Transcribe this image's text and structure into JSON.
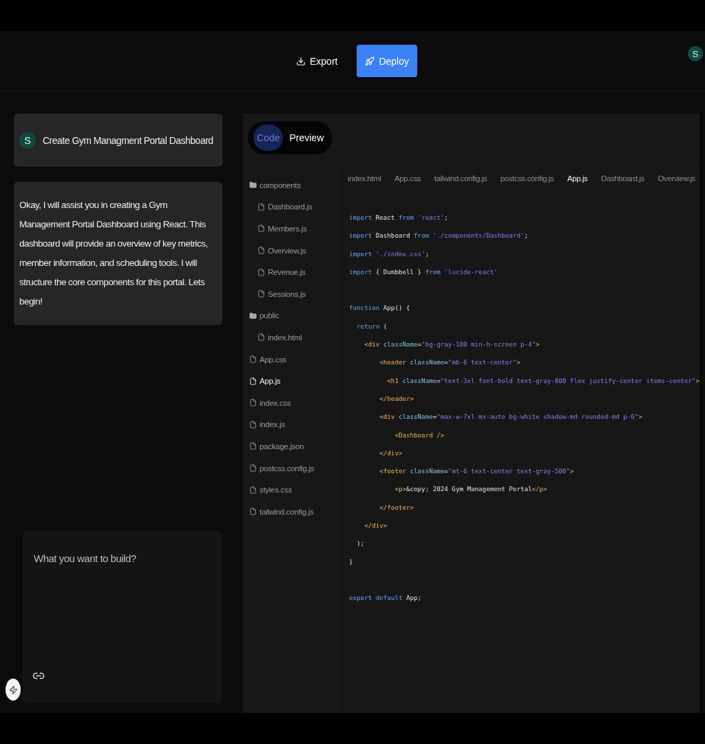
{
  "header": {
    "buttons": [
      {
        "label": "Export",
        "kind": "export"
      },
      {
        "label": "Deploy",
        "kind": "deploy"
      }
    ],
    "avatar": "S"
  },
  "chat": {
    "messages": [
      {
        "kind": "user",
        "avatar": "S",
        "text": "Create Gym Managment Portal Dashboard"
      },
      {
        "kind": "assistant",
        "text": "Okay, I will assist you in creating a Gym Management Portal Dashboard using React. This dashboard will provide an overview of key metrics, member information, and scheduling tools. I will structure the core components for this portal. Lets begin!"
      }
    ],
    "prompt": {
      "placeholder": "What you want to build?"
    }
  },
  "view_toggle": [
    {
      "label": "Code",
      "selected": true
    },
    {
      "label": "Preview",
      "selected": false
    }
  ],
  "file_tree": [
    {
      "name": "components",
      "kind": "folder",
      "selected": false,
      "children": [
        {
          "name": "Dashboard.js",
          "kind": "file",
          "selected": false
        },
        {
          "name": "Members.js",
          "kind": "file",
          "selected": false
        },
        {
          "name": "Overview.js",
          "kind": "file",
          "selected": false
        },
        {
          "name": "Revenue.js",
          "kind": "file",
          "selected": false
        },
        {
          "name": "Sessions.js",
          "kind": "file",
          "selected": false
        }
      ]
    },
    {
      "name": "public",
      "kind": "folder",
      "selected": false,
      "children": [
        {
          "name": "index.html",
          "kind": "file",
          "selected": false
        }
      ]
    },
    {
      "name": "App.css",
      "kind": "file",
      "selected": false
    },
    {
      "name": "App.js",
      "kind": "file",
      "selected": true
    },
    {
      "name": "index.css",
      "kind": "file",
      "selected": false
    },
    {
      "name": "index.js",
      "kind": "file",
      "selected": false
    },
    {
      "name": "package.json",
      "kind": "file",
      "selected": false
    },
    {
      "name": "postcss.config.js",
      "kind": "file",
      "selected": false
    },
    {
      "name": "styles.css",
      "kind": "file",
      "selected": false
    },
    {
      "name": "tailwind.config.js",
      "kind": "file",
      "selected": false
    }
  ],
  "editor_tabs": [
    {
      "label": "index.html",
      "selected": false
    },
    {
      "label": "App.css",
      "selected": false
    },
    {
      "label": "tailwind.config.js",
      "selected": false
    },
    {
      "label": "postcss.config.js",
      "selected": false
    },
    {
      "label": "App.js",
      "selected": true
    },
    {
      "label": "Dashboard.js",
      "selected": false
    },
    {
      "label": "Overview.js",
      "selected": false
    }
  ],
  "code_blocks": [
    [
      [
        {
          "kind": "keyword",
          "text": "import"
        },
        {
          "kind": "plain",
          "text": " React "
        },
        {
          "kind": "keyword",
          "text": "from"
        },
        {
          "kind": "string",
          "text": " 'react'"
        },
        {
          "kind": "plain",
          "text": ";"
        }
      ],
      [
        {
          "kind": "keyword",
          "text": "import"
        },
        {
          "kind": "plain",
          "text": " Dashboard "
        },
        {
          "kind": "keyword",
          "text": "from"
        },
        {
          "kind": "string",
          "text": " './components/Dashboard'"
        },
        {
          "kind": "plain",
          "text": ";"
        }
      ],
      [
        {
          "kind": "keyword",
          "text": "import"
        },
        {
          "kind": "string",
          "text": " './index.css'"
        },
        {
          "kind": "plain",
          "text": ";"
        }
      ],
      [
        {
          "kind": "keyword",
          "text": "import"
        },
        {
          "kind": "plain",
          "text": " { Dumbbell } "
        },
        {
          "kind": "keyword",
          "text": "from"
        },
        {
          "kind": "string",
          "text": " 'lucide-react'"
        }
      ]
    ],
    [
      [
        {
          "kind": "keyword",
          "text": "function"
        },
        {
          "kind": "plain",
          "text": " App() {"
        }
      ],
      [
        {
          "kind": "keyword",
          "text": "  return"
        },
        {
          "kind": "plain",
          "text": " ("
        }
      ],
      [
        {
          "kind": "tag",
          "text": "    <div"
        },
        {
          "kind": "attr",
          "text": " className"
        },
        {
          "kind": "plain",
          "text": "="
        },
        {
          "kind": "string",
          "text": "\"bg-gray-100 min-h-screen p-4\""
        },
        {
          "kind": "tag",
          "text": ">"
        }
      ],
      [
        {
          "kind": "tag",
          "text": "        <header"
        },
        {
          "kind": "attr",
          "text": " className"
        },
        {
          "kind": "plain",
          "text": "="
        },
        {
          "kind": "string",
          "text": "\"mb-6 text-center\""
        },
        {
          "kind": "tag",
          "text": ">"
        }
      ],
      [
        {
          "kind": "tag",
          "text": "          <h1"
        },
        {
          "kind": "attr",
          "text": " className"
        },
        {
          "kind": "plain",
          "text": "="
        },
        {
          "kind": "string",
          "text": "\"text-3xl font-bold text-gray-800 flex justify-center items-center\""
        },
        {
          "kind": "tag",
          "text": ">"
        }
      ],
      [
        {
          "kind": "tag",
          "text": "        </header>"
        }
      ],
      [
        {
          "kind": "tag",
          "text": "        <div"
        },
        {
          "kind": "attr",
          "text": " className"
        },
        {
          "kind": "plain",
          "text": "="
        },
        {
          "kind": "string",
          "text": "\"max-w-7xl mx-auto bg-white shadow-md rounded-md p-6\""
        },
        {
          "kind": "tag",
          "text": ">"
        }
      ],
      [
        {
          "kind": "tag",
          "text": "            <Dashboard />"
        }
      ],
      [
        {
          "kind": "tag",
          "text": "        </div>"
        }
      ],
      [
        {
          "kind": "tag",
          "text": "        <footer"
        },
        {
          "kind": "attr",
          "text": " className"
        },
        {
          "kind": "plain",
          "text": "="
        },
        {
          "kind": "string",
          "text": "\"mt-6 text-center text-gray-500\""
        },
        {
          "kind": "tag",
          "text": ">"
        }
      ],
      [
        {
          "kind": "tag",
          "text": "            <p>"
        },
        {
          "kind": "plain",
          "text": "&copy; 2024 Gym Management Portal"
        },
        {
          "kind": "tag",
          "text": "</p>"
        }
      ],
      [
        {
          "kind": "tag",
          "text": "        </footer>"
        }
      ],
      [
        {
          "kind": "tag",
          "text": "    </div>"
        }
      ],
      [
        {
          "kind": "plain",
          "text": "  );"
        }
      ],
      [
        {
          "kind": "plain",
          "text": "}"
        }
      ]
    ],
    [
      [
        {
          "kind": "keyword",
          "text": "export default"
        },
        {
          "kind": "plain",
          "text": " App;"
        }
      ]
    ]
  ]
}
